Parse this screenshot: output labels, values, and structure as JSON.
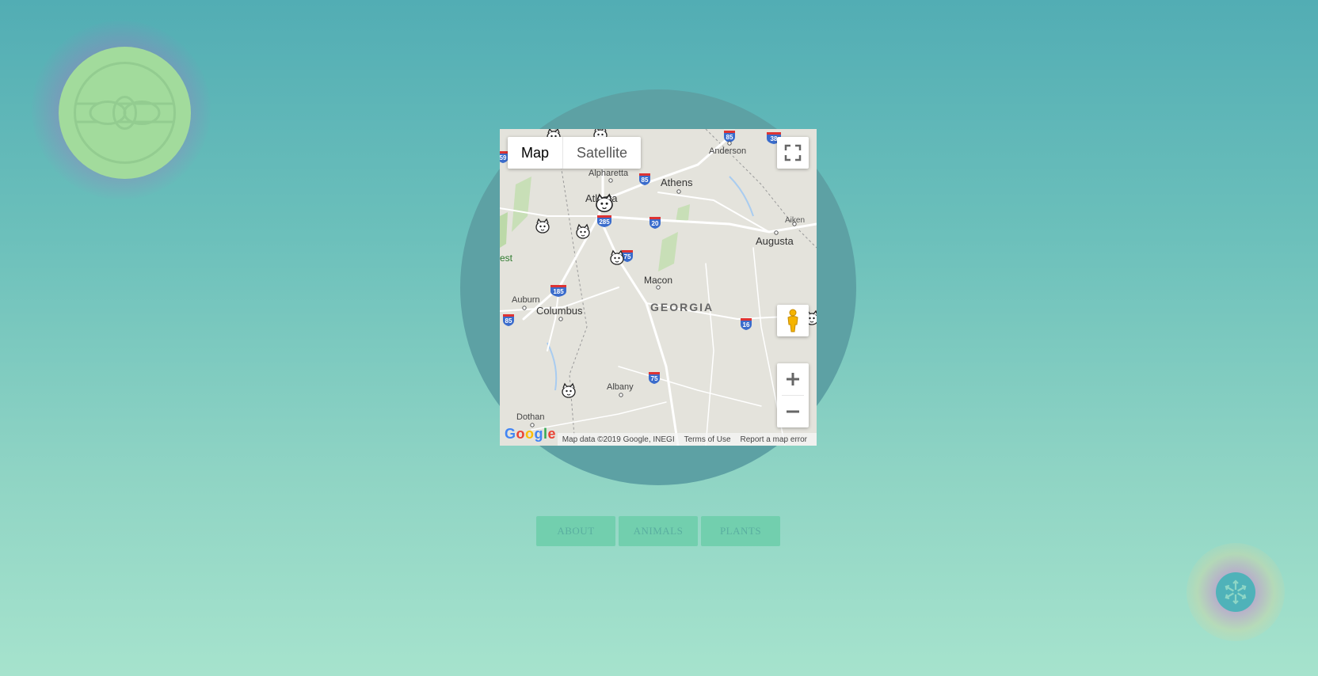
{
  "logo": {
    "icon": "knot-emblem-icon",
    "color": "#a2db9c"
  },
  "map": {
    "map_types": [
      {
        "label": "Map",
        "active": true
      },
      {
        "label": "Satellite",
        "active": false
      }
    ],
    "places": {
      "alpharetta": "Alpharetta",
      "athens": "Athens",
      "anderson": "Anderson",
      "atlanta": "Atlanta",
      "aiken": "Aiken",
      "augusta": "Augusta",
      "macon": "Macon",
      "auburn": "Auburn",
      "columbus": "Columbus",
      "georgia": "GEORGIA",
      "albany": "Albany",
      "dothan": "Dothan",
      "west": "est"
    },
    "highway_shields": [
      "85",
      "38",
      "59",
      "285",
      "20",
      "75",
      "185",
      "85",
      "16",
      "75",
      "85"
    ],
    "attribution": {
      "data": "Map data ©2019 Google, INEGI",
      "terms": "Terms of Use",
      "report": "Report a map error"
    },
    "google_logo": "Google",
    "zoom_in_icon": "plus-icon",
    "zoom_out_icon": "minus-icon"
  },
  "nav": {
    "about": "ABOUT",
    "animals": "ANIMALS",
    "plants": "PLANTS"
  },
  "badge": {
    "icon": "flower-icon",
    "color": "#4fb2b9"
  }
}
